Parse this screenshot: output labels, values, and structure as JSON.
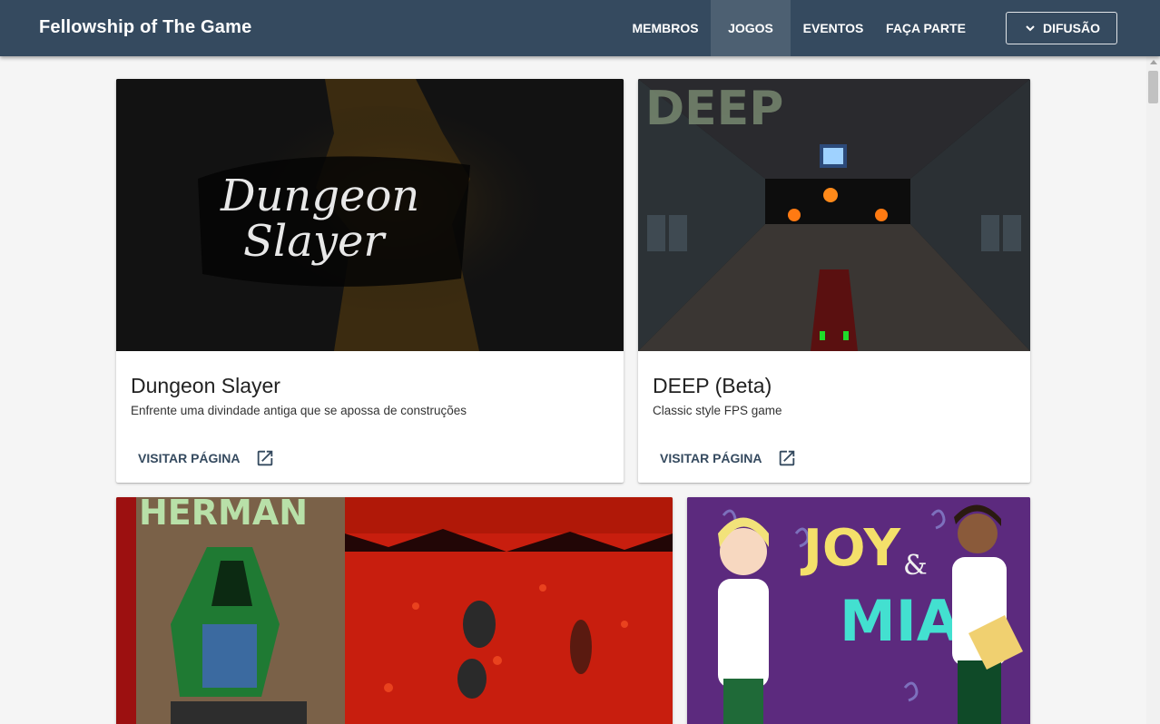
{
  "app": {
    "title": "Fellowship of The Game"
  },
  "nav": {
    "items": [
      {
        "label": "MEMBROS",
        "active": false
      },
      {
        "label": "JOGOS",
        "active": true
      },
      {
        "label": "EVENTOS",
        "active": false
      },
      {
        "label": "FAÇA PARTE",
        "active": false
      }
    ],
    "dropdown_label": "DIFUSÃO",
    "dropdown_icon": "chevron-down-icon"
  },
  "colors": {
    "appbar": "#354a5f",
    "accent": "#354a5f",
    "background": "#f5f5f5"
  },
  "cards": [
    {
      "title": "Dungeon Slayer",
      "subtitle": "Enfrente uma divindade antiga que se apossa de construções",
      "action": "VISITAR PÁGINA",
      "action_icon": "open-in-new-icon",
      "image_text": [
        "Dungeon",
        "Slayer"
      ]
    },
    {
      "title": "DEEP (Beta)",
      "subtitle": "Classic style FPS game",
      "action": "VISITAR PÁGINA",
      "action_icon": "open-in-new-icon",
      "image_text": [
        "DEEP"
      ]
    },
    {
      "image_text": [
        "HERMAN"
      ]
    },
    {
      "image_text": [
        "JOY",
        "&",
        "MIA"
      ]
    }
  ]
}
